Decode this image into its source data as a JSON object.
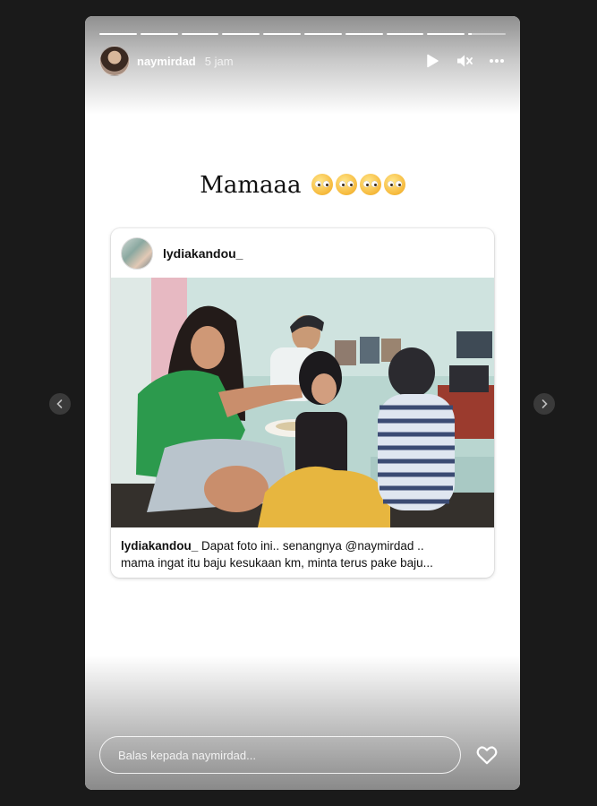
{
  "story": {
    "username": "naymirdad",
    "time_ago": "5 jam",
    "progress": {
      "segments": 10,
      "current_index": 9,
      "current_fraction": 0.1
    }
  },
  "caption": {
    "text": "Mamaaa",
    "emoji_count": 4,
    "emoji": "pleading-face"
  },
  "shared_post": {
    "username": "lydiakandou_",
    "caption_user": "lydiakandou_",
    "caption_line1": " Dapat foto ini.. senangnya @naymirdad ..",
    "caption_line2": "mama ingat itu baju kesukaan km, minta terus pake baju..."
  },
  "reply": {
    "placeholder": "Balas kepada naymirdad..."
  },
  "icons": {
    "play": "play-icon",
    "mute": "muted-speaker-icon",
    "more": "more-icon",
    "heart": "heart-icon",
    "prev": "chevron-left-icon",
    "next": "chevron-right-icon"
  }
}
